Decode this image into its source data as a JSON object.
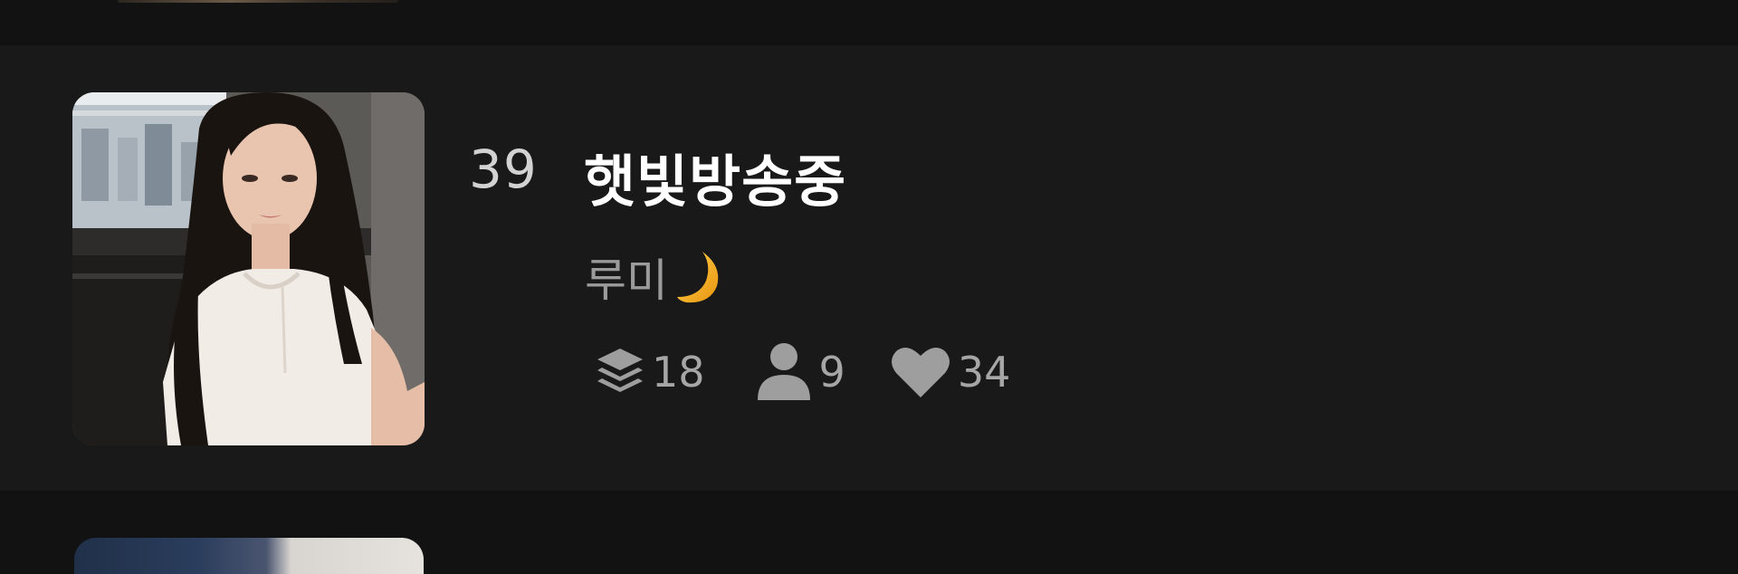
{
  "item": {
    "rank": "39",
    "title": "햇빛방송중",
    "creator_name": "루미",
    "creator_icon": "crescent-moon-icon",
    "stats": {
      "episodes": "18",
      "episodes_icon": "layers-icon",
      "followers": "9",
      "followers_icon": "person-icon",
      "likes": "34",
      "likes_icon": "heart-icon"
    }
  },
  "colors": {
    "background": "#121212",
    "card": "#191919",
    "title": "#ffffff",
    "rank": "#d2d2d2",
    "secondary": "#9b9b9b",
    "moon": "#f2a51c"
  }
}
